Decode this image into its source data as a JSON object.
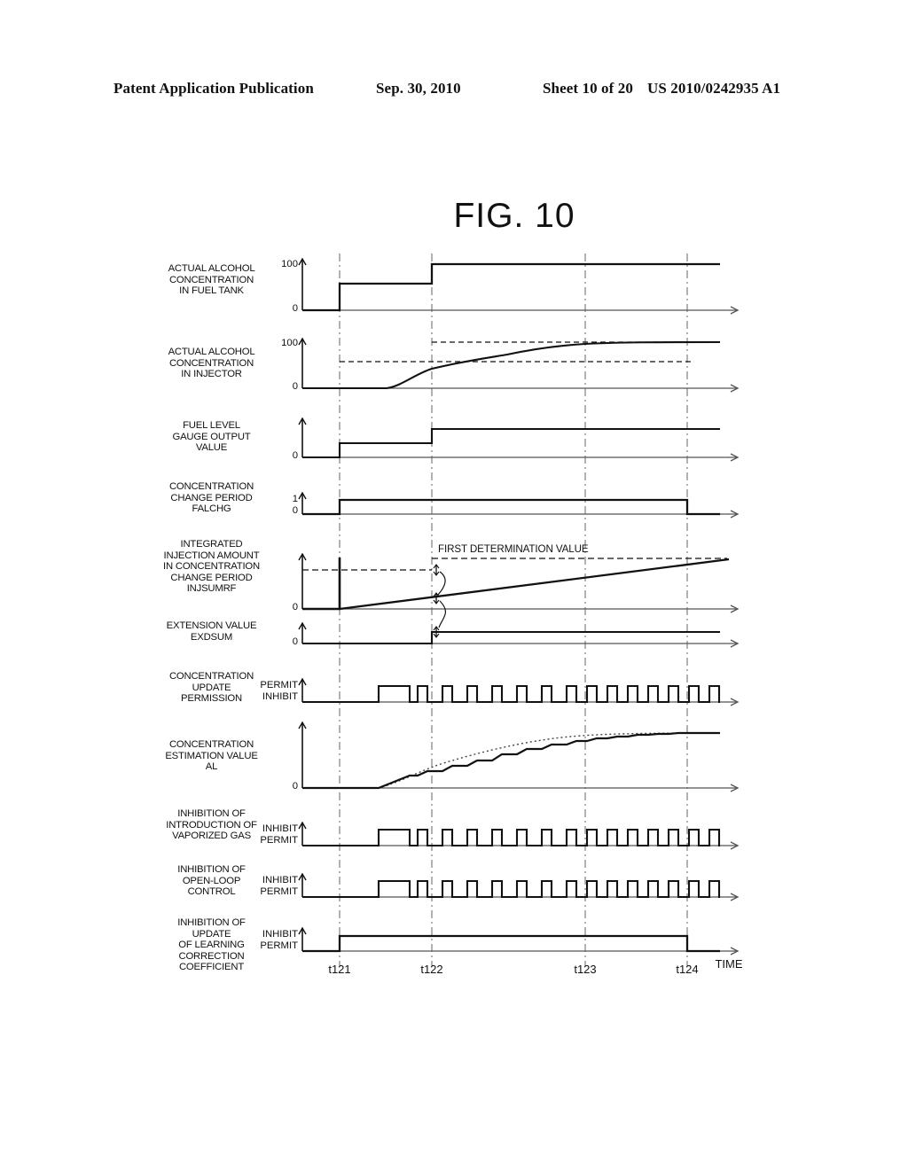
{
  "header": {
    "publication": "Patent Application Publication",
    "date": "Sep. 30, 2010",
    "sheet": "Sheet 10 of 20",
    "docnum": "US 2010/0242935 A1"
  },
  "figure": {
    "title": "FIG. 10"
  },
  "chart_data": {
    "type": "line",
    "title": "FIG. 10",
    "xlabel": "TIME",
    "grid": false,
    "legend": "none",
    "time_markers": [
      "t121",
      "t122",
      "t123",
      "t124"
    ],
    "time_axis_label": "TIME",
    "annotations": [
      {
        "text": "FIRST DETERMINATION VALUE",
        "panel": "integrated-injection-amount"
      }
    ],
    "panels": [
      {
        "id": "actual-alcohol-concentration-in-fuel-tank",
        "label": "ACTUAL ALCOHOL\nCONCENTRATION\nIN FUEL TANK",
        "y_ticks": [
          "100",
          "0"
        ],
        "ylim": [
          0,
          100
        ],
        "trace_type": "step",
        "points": [
          [
            0,
            0
          ],
          [
            1,
            0
          ],
          [
            1,
            50
          ],
          [
            2,
            50
          ],
          [
            2,
            95
          ],
          [
            4,
            95
          ]
        ],
        "description": "Steps from 0 up to mid-level at t121, then to 100 at t122."
      },
      {
        "id": "actual-alcohol-concentration-in-injector",
        "label": "ACTUAL ALCOHOL\nCONCENTRATION\nIN INJECTOR",
        "y_ticks": [
          "100",
          "0"
        ],
        "ylim": [
          0,
          100
        ],
        "trace_type": "curve",
        "dashed_levels": [
          50,
          95
        ],
        "description": "Flat at 0 until shortly after t121, then S-curve rising asymptotically toward 100 by t123."
      },
      {
        "id": "fuel-level-gauge-output-value",
        "label": "FUEL LEVEL\nGAUGE OUTPUT\nVALUE",
        "y_ticks": [
          "0"
        ],
        "trace_type": "step",
        "points": [
          [
            0,
            0
          ],
          [
            1,
            0
          ],
          [
            1,
            30
          ],
          [
            2,
            30
          ],
          [
            2,
            62
          ],
          [
            4,
            62
          ]
        ],
        "description": "Two up-steps at t121 and t122."
      },
      {
        "id": "concentration-change-period-falchg",
        "label": "CONCENTRATION\nCHANGE PERIOD\nFALCHG",
        "y_ticks": [
          "1",
          "0"
        ],
        "ylim": [
          0,
          1
        ],
        "trace_type": "step",
        "points": [
          [
            0,
            0
          ],
          [
            1,
            0
          ],
          [
            1,
            1
          ],
          [
            3.67,
            1
          ],
          [
            3.67,
            0
          ],
          [
            4,
            0
          ]
        ],
        "description": "Goes to 1 at t121, returns to 0 at t124."
      },
      {
        "id": "integrated-injection-amount-injsumrf",
        "label": "INTEGRATED\nINJECTION AMOUNT\nIN CONCENTRATION\nCHANGE PERIOD\nINJSUMRF",
        "y_ticks": [
          "0"
        ],
        "trace_type": "ramp",
        "dashed_levels": [
          "first determination value"
        ],
        "description": "Resets to 0 at t121 then ramps linearly upward, crossing the first determination value dashed line near the right edge."
      },
      {
        "id": "extension-value-exdsum",
        "label": "EXTENSION VALUE\nEXDSUM",
        "y_ticks": [
          "0"
        ],
        "trace_type": "step",
        "points": [
          [
            0,
            0
          ],
          [
            2,
            0
          ],
          [
            2,
            1
          ],
          [
            4,
            1
          ]
        ],
        "description": "Steps up at t122 and stays."
      },
      {
        "id": "concentration-update-permission",
        "label": "CONCENTRATION\nUPDATE\nPERMISSION",
        "y_ticks": [
          "PERMIT",
          "INHIBIT"
        ],
        "trace_type": "pulse",
        "description": "INHIBIT until a wide PERMIT pulse before t122, then a regular train of narrow PERMIT pulses through t124."
      },
      {
        "id": "concentration-estimation-value-al",
        "label": "CONCENTRATION\nESTIMATION VALUE\nAL",
        "y_ticks": [
          "0"
        ],
        "trace_type": "staircase",
        "description": "Staircase rising in steps coinciding with the update pulses, tracking a dotted smooth reference curve, saturating after t123."
      },
      {
        "id": "inhibition-of-introduction-of-vaporized-gas",
        "label": "INHIBITION OF\nINTRODUCTION OF\nVAPORIZED GAS",
        "y_ticks": [
          "INHIBIT",
          "PERMIT"
        ],
        "trace_type": "pulse",
        "description": "Same pulse pattern as the update permission signal."
      },
      {
        "id": "inhibition-of-open-loop-control",
        "label": "INHIBITION OF\nOPEN-LOOP\nCONTROL",
        "y_ticks": [
          "INHIBIT",
          "PERMIT"
        ],
        "trace_type": "pulse",
        "description": "Same pulse pattern as the update permission signal."
      },
      {
        "id": "inhibition-of-update-of-learning-correction-coefficient",
        "label": "INHIBITION OF\nUPDATE\nOF LEARNING\nCORRECTION\nCOEFFICIENT",
        "y_ticks": [
          "INHIBIT",
          "PERMIT"
        ],
        "trace_type": "step",
        "points": [
          [
            0,
            0
          ],
          [
            1,
            0
          ],
          [
            1,
            1
          ],
          [
            3.67,
            1
          ],
          [
            3.67,
            0
          ],
          [
            4,
            0
          ]
        ],
        "description": "INHIBIT from t121 to t124, then PERMIT."
      }
    ]
  }
}
